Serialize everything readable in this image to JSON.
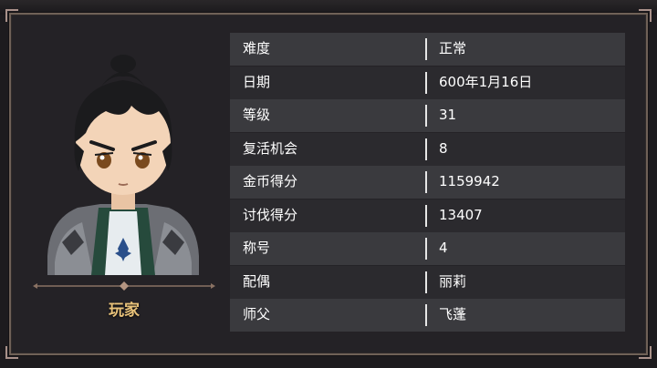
{
  "player": {
    "name": "玩家"
  },
  "stats": [
    {
      "label": "难度",
      "value": "正常"
    },
    {
      "label": "日期",
      "value": "600年1月16日"
    },
    {
      "label": "等级",
      "value": "31"
    },
    {
      "label": "复活机会",
      "value": "8"
    },
    {
      "label": "金币得分",
      "value": "1159942"
    },
    {
      "label": "讨伐得分",
      "value": "13407"
    },
    {
      "label": "称号",
      "value": "4"
    },
    {
      "label": "配偶",
      "value": "丽莉"
    },
    {
      "label": "师父",
      "value": "飞蓬"
    }
  ],
  "colors": {
    "panel_border": "#6f6157",
    "name_gold": "#e8c27a",
    "row_light": "#3a3a3e",
    "row_dark": "#2b2a2e"
  }
}
